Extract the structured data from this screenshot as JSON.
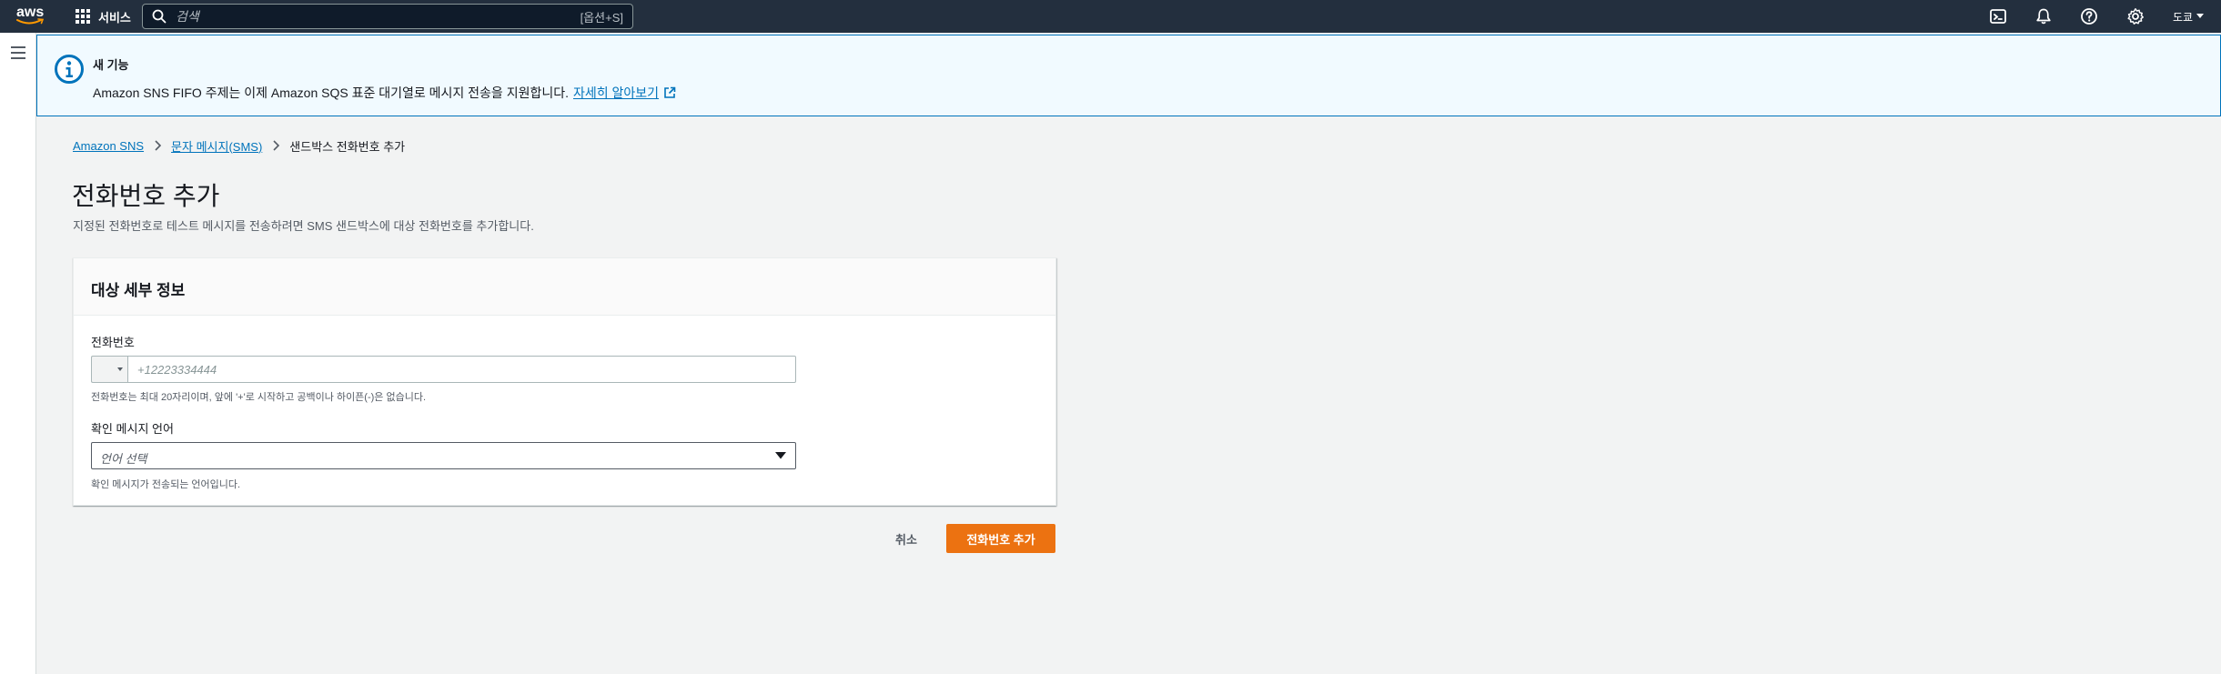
{
  "topnav": {
    "logo_text": "aws",
    "services_label": "서비스",
    "search_placeholder": "검색",
    "search_shortcut": "[옵션+S]",
    "region_label": "도쿄"
  },
  "flash": {
    "title": "새 기능",
    "message": "Amazon SNS FIFO 주제는 이제 Amazon SQS 표준 대기열로 메시지 전송을 지원합니다.",
    "link_label": "자세히 알아보기"
  },
  "breadcrumb": {
    "items": [
      "Amazon SNS",
      "문자 메시지(SMS)"
    ],
    "current": "샌드박스 전화번호 추가"
  },
  "page": {
    "title": "전화번호 추가",
    "description": "지정된 전화번호로 테스트 메시지를 전송하려면 SMS 샌드박스에 대상 전화번호를 추가합니다."
  },
  "form": {
    "section_title": "대상 세부 정보",
    "phone": {
      "label": "전화번호",
      "value": "",
      "placeholder": "+12223334444",
      "hint": "전화번호는 최대 20자리이며, 앞에 '+'로 시작하고 공백이나 하이픈(-)은 없습니다."
    },
    "language": {
      "label": "확인 메시지 언어",
      "placeholder": "언어 선택",
      "hint": "확인 메시지가 전송되는 언어입니다."
    }
  },
  "actions": {
    "cancel_label": "취소",
    "submit_label": "전화번호 추가"
  },
  "colors": {
    "nav_bg": "#232f3e",
    "link": "#0073bb",
    "primary": "#ec7211",
    "flash_bg": "#f1faff"
  },
  "icons": {
    "services": "grid-icon",
    "search": "search-icon",
    "cloudshell": "terminal-icon",
    "notifications": "bell-icon",
    "help": "help-icon",
    "settings": "gear-icon",
    "menu": "hamburger-icon",
    "info": "info-icon",
    "external": "external-link-icon"
  }
}
